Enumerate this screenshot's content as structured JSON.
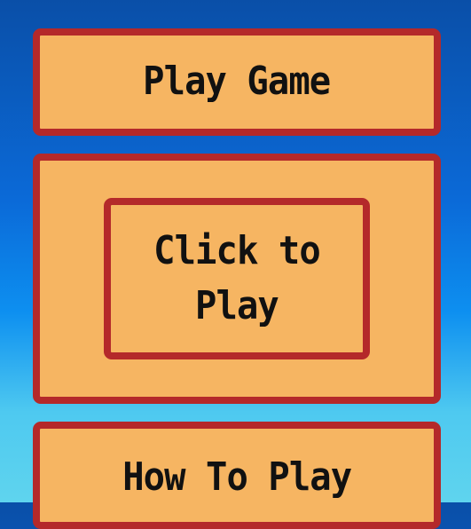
{
  "menu": {
    "play_game_label": "Play Game",
    "click_to_play_line1": "Click to",
    "click_to_play_line2": "Play",
    "how_to_play_label": "How To Play"
  },
  "colors": {
    "panel_fill": "#f6b562",
    "panel_border": "#b4292a",
    "background_top": "#0a4fa8",
    "background_bottom": "#5fd4ee"
  }
}
